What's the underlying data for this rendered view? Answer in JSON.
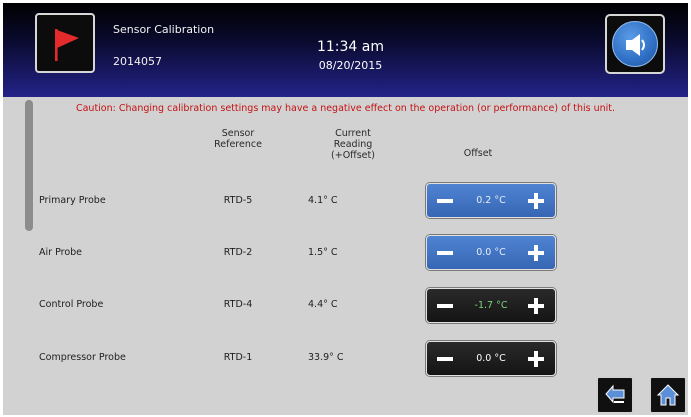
{
  "header": {
    "title": "Sensor Calibration",
    "unit_id": "2014057",
    "time": "11:34 am",
    "date": "08/20/2015"
  },
  "caution": "Caution: Changing calibration settings may have a negative effect on the operation (or performance) of this unit.",
  "columns": {
    "reference_l1": "Sensor",
    "reference_l2": "Reference",
    "reading_l1": "Current",
    "reading_l2": "Reading",
    "reading_l3": "(+Offset)",
    "offset": "Offset"
  },
  "rows": [
    {
      "label": "Primary Probe",
      "reference": "RTD-5",
      "reading": "4.1° C",
      "offset": "0.2 °C",
      "style": "blue"
    },
    {
      "label": "Air Probe",
      "reference": "RTD-2",
      "reading": "1.5° C",
      "offset": "0.0 °C",
      "style": "blue"
    },
    {
      "label": "Control Probe",
      "reference": "RTD-4",
      "reading": "4.4° C",
      "offset": "-1.7 °C",
      "style": "dark"
    },
    {
      "label": "Compressor Probe",
      "reference": "RTD-1",
      "reading": "33.9° C",
      "offset": "0.0 °C",
      "style": "dark"
    }
  ],
  "icons": {
    "flag": "flag-icon",
    "sound": "speaker-icon",
    "back": "back-arrow-icon",
    "home": "home-icon"
  },
  "colors": {
    "header_gradient_end": "#23238a",
    "caution_text": "#c41212",
    "stepper_blue": "#3f73c4",
    "stepper_dark": "#1c1c1c",
    "negative_value": "#7fd27f",
    "flag_red": "#e32b2b"
  }
}
